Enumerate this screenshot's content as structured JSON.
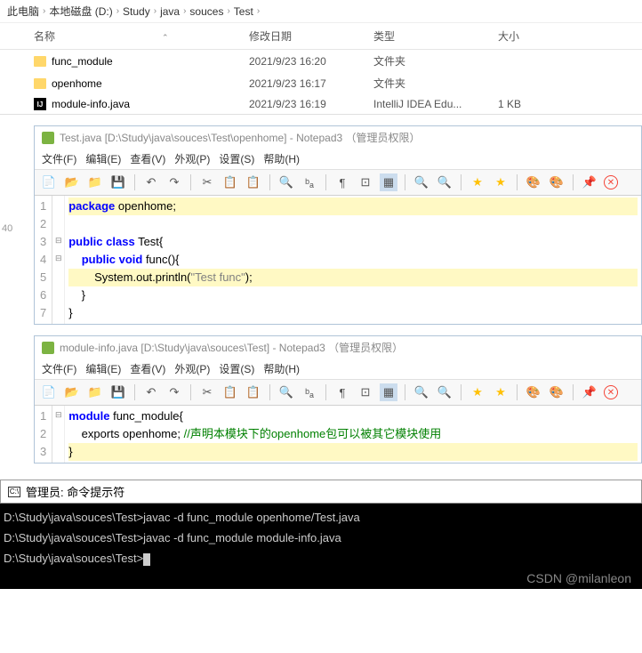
{
  "breadcrumb": [
    "此电脑",
    "本地磁盘 (D:)",
    "Study",
    "java",
    "souces",
    "Test"
  ],
  "explorer": {
    "headers": {
      "name": "名称",
      "date": "修改日期",
      "type": "类型",
      "size": "大小"
    },
    "rows": [
      {
        "icon": "folder",
        "name": "func_module",
        "date": "2021/9/23 16:20",
        "type": "文件夹",
        "size": ""
      },
      {
        "icon": "folder",
        "name": "openhome",
        "date": "2021/9/23 16:17",
        "type": "文件夹",
        "size": ""
      },
      {
        "icon": "ij",
        "name": "module-info.java",
        "date": "2021/9/23 16:19",
        "type": "IntelliJ IDEA Edu...",
        "size": "1 KB"
      }
    ]
  },
  "left_number": "40",
  "np1": {
    "title": "Test.java [D:\\Study\\java\\souces\\Test\\openhome] - Notepad3  （管理员权限）",
    "menu": [
      "文件(F)",
      "编辑(E)",
      "查看(V)",
      "外观(P)",
      "设置(S)",
      "帮助(H)"
    ],
    "lines": [
      "1",
      "2",
      "3",
      "4",
      "5",
      "6",
      "7"
    ],
    "code": {
      "l1_kw": "package",
      "l1_rest": " openhome;",
      "l3_kw1": "public",
      "l3_kw2": "class",
      "l3_rest": " Test{",
      "l4_kw1": "public",
      "l4_kw2": "void",
      "l4_rest": " func(){",
      "l5_pre": "        System.out.println(",
      "l5_str": "\"Test func\"",
      "l5_post": ");",
      "l6": "    }",
      "l7": "}"
    }
  },
  "np2": {
    "title": "module-info.java [D:\\Study\\java\\souces\\Test] - Notepad3  （管理员权限）",
    "menu": [
      "文件(F)",
      "编辑(E)",
      "查看(V)",
      "外观(P)",
      "设置(S)",
      "帮助(H)"
    ],
    "lines": [
      "1",
      "2",
      "3"
    ],
    "code": {
      "l1_kw": "module",
      "l1_rest": " func_module{",
      "l2_pre": "    exports openhome; ",
      "l2_cmt": "//声明本模块下的openhome包可以被其它模块使用",
      "l3": "}"
    }
  },
  "terminal": {
    "title": "管理员: 命令提示符",
    "lines": [
      "D:\\Study\\java\\souces\\Test>javac -d func_module openhome/Test.java",
      "",
      "D:\\Study\\java\\souces\\Test>javac -d func_module module-info.java",
      "",
      "D:\\Study\\java\\souces\\Test>"
    ]
  },
  "watermark": "CSDN @milanleon"
}
